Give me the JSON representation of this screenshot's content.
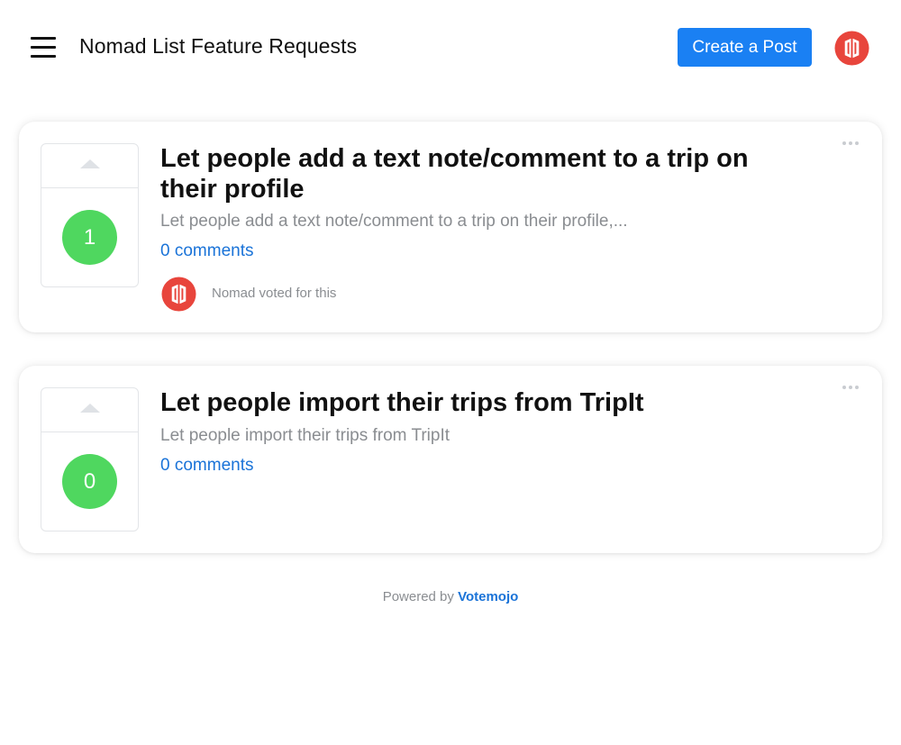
{
  "header": {
    "title": "Nomad List Feature Requests",
    "create_button_label": "Create a Post",
    "menu_icon": "hamburger-menu-icon",
    "avatar_icon": "nomad-logo-avatar"
  },
  "posts": [
    {
      "title": "Let people add a text note/comment to a trip on their profile",
      "excerpt": "Let people add a text note/comment to a trip on their profile,...",
      "votes": "1",
      "comments": "0 comments",
      "voter_text": "Nomad voted for this"
    },
    {
      "title": "Let people import their trips from TripIt",
      "excerpt": "Let people import their trips from TripIt",
      "votes": "0",
      "comments": "0 comments"
    }
  ],
  "footer": {
    "prefix": "Powered by",
    "brand": "Votemojo"
  },
  "colors": {
    "primary_button": "#1a80f3",
    "vote_badge": "#4fd75f",
    "link": "#1a73d8",
    "avatar_red": "#e8453c"
  }
}
